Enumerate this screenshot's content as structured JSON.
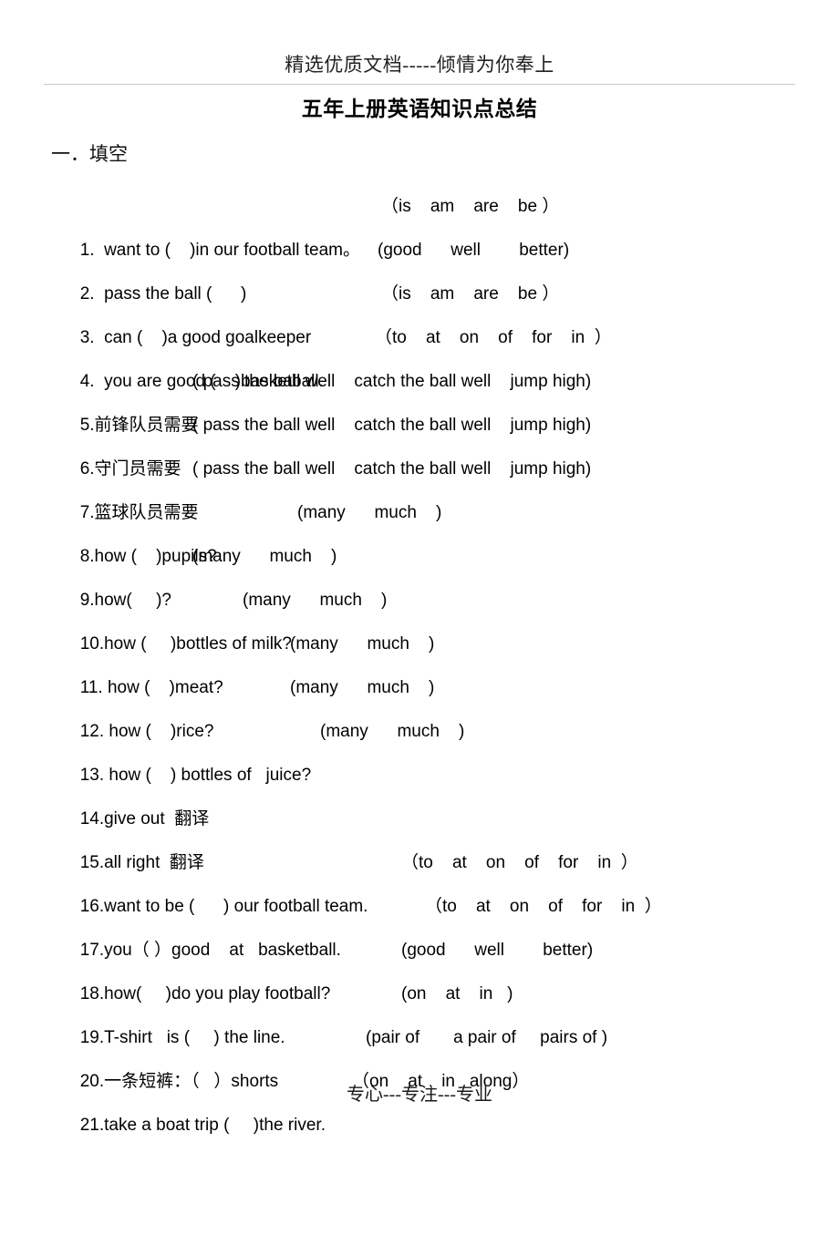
{
  "header": {
    "running_head": "精选优质文档-----倾情为你奉上"
  },
  "title": "五年上册英语知识点总结",
  "section": {
    "heading": "一．填空"
  },
  "questions": [
    {
      "stem": "1.  want to (    )in our football team。",
      "options": "（is    am    are    be ）"
    },
    {
      "stem": "2.  pass the ball (      )",
      "options": "(good      well        better)"
    },
    {
      "stem": "3.  can (    )a good goalkeeper",
      "options": "（is    am    are    be ）"
    },
    {
      "stem": "4.  you are good (    )basketball.",
      "options": "（to    at    on    of    for    in  ）"
    },
    {
      "stem": "5.前锋队员需要",
      "options": "( pass the ball well    catch the ball well    jump high)"
    },
    {
      "stem": "6.守门员需要",
      "options": "( pass the ball well    catch the ball well    jump high)"
    },
    {
      "stem": "7.篮球队员需要",
      "options": "( pass the ball well    catch the ball well    jump high)"
    },
    {
      "stem": "8.how (    )pupils?",
      "options": "(many      much    )"
    },
    {
      "stem": "9.how(     )?",
      "options": "(many      much    )"
    },
    {
      "stem": "10.how (     )bottles of milk?",
      "options": "(many      much    )"
    },
    {
      "stem": "11. how (    )meat?",
      "options": "(many      much    )"
    },
    {
      "stem": "12. how (    )rice?",
      "options": "(many      much    )"
    },
    {
      "stem": "13. how (    ) bottles of   juice?",
      "options": "(many      much    )"
    },
    {
      "stem": "14.give out  翻译",
      "options": ""
    },
    {
      "stem": "15.all right  翻译",
      "options": ""
    },
    {
      "stem": "16.want to be (      ) our football team.",
      "options": "（to    at    on    of    for    in  ）"
    },
    {
      "stem": "17.you（ ）good    at   basketball.",
      "options": "（to    at    on    of    for    in  ）"
    },
    {
      "stem": "18.how(     )do you play football?",
      "options": "(good      well        better)"
    },
    {
      "stem": "19.T-shirt   is (     ) the line.",
      "options": "(on    at    in   )"
    },
    {
      "stem": "20.一条短裤：（   ）shorts",
      "options": "(pair of       a pair of     pairs of )"
    },
    {
      "stem": "21.take a boat trip (     )the river.",
      "options": "（on    at    in   along）"
    }
  ],
  "footer": {
    "text": "专心---专注---专业"
  }
}
